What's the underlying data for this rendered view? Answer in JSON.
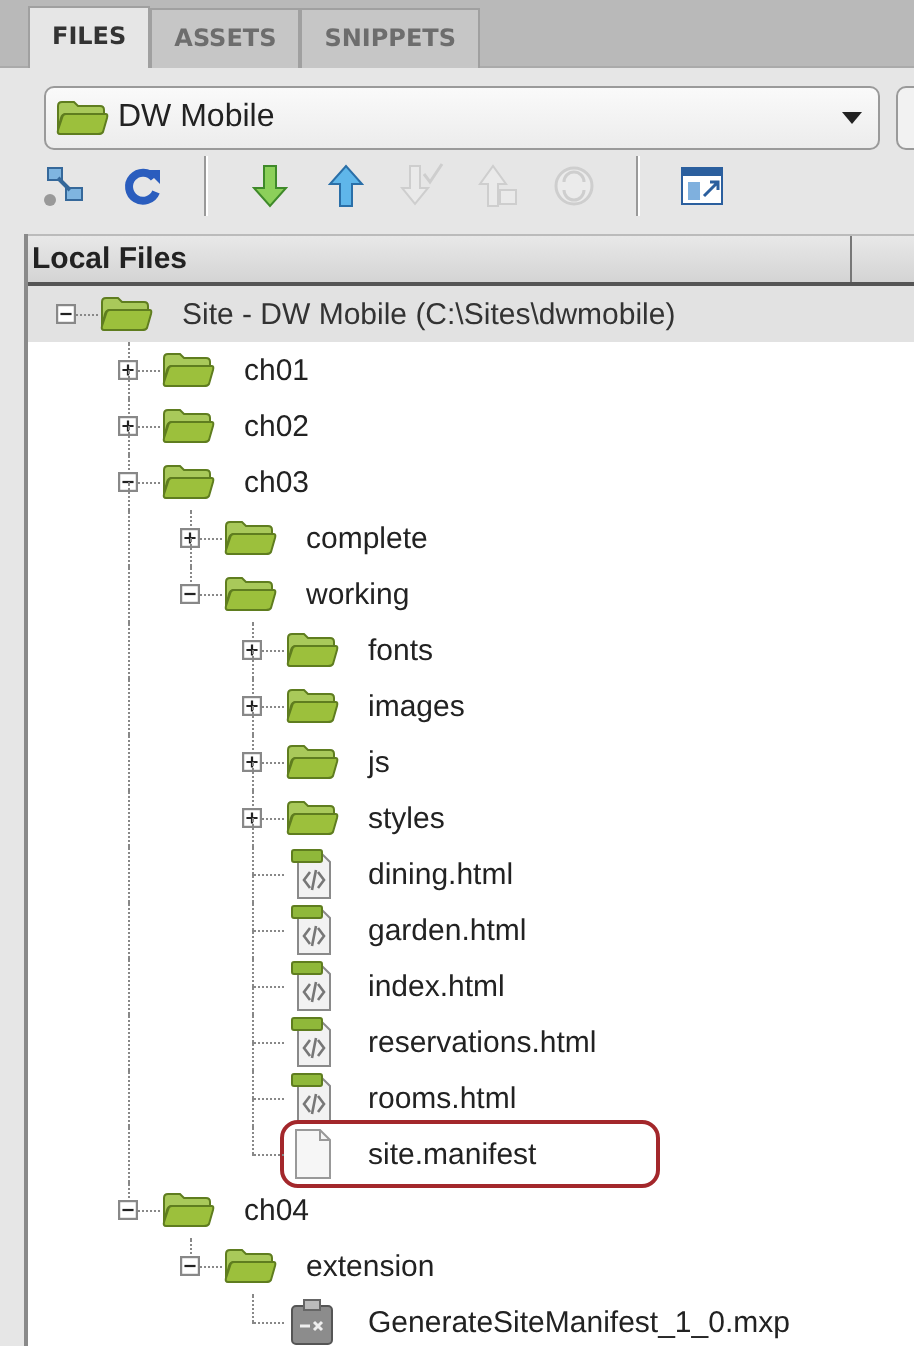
{
  "tabs": [
    {
      "label": "FILES",
      "selected": true
    },
    {
      "label": "ASSETS",
      "selected": false
    },
    {
      "label": "SNIPPETS",
      "selected": false
    }
  ],
  "site_select": {
    "value": "DW Mobile"
  },
  "toolbar": [
    {
      "kind": "connect",
      "disabled": false
    },
    {
      "kind": "refresh",
      "disabled": false
    },
    {
      "kind": "separator"
    },
    {
      "kind": "get",
      "disabled": false
    },
    {
      "kind": "put",
      "disabled": false
    },
    {
      "kind": "check_in",
      "disabled": true
    },
    {
      "kind": "check_out",
      "disabled": true
    },
    {
      "kind": "synchronize",
      "disabled": true
    },
    {
      "kind": "separator"
    },
    {
      "kind": "expand",
      "disabled": false
    }
  ],
  "file_list": {
    "column_1": "Local Files"
  },
  "tree": [
    {
      "name": "Site - DW Mobile (C:\\Sites\\dwmobile)",
      "kind": "folder",
      "expanded": true,
      "selected": true,
      "highlighted": false,
      "children": [
        {
          "name": "ch01",
          "kind": "folder",
          "expanded": false,
          "selected": false,
          "highlighted": false
        },
        {
          "name": "ch02",
          "kind": "folder",
          "expanded": false,
          "selected": false,
          "highlighted": false
        },
        {
          "name": "ch03",
          "kind": "folder",
          "expanded": true,
          "selected": false,
          "highlighted": false,
          "children": [
            {
              "name": "complete",
              "kind": "folder",
              "expanded": false,
              "selected": false,
              "highlighted": false
            },
            {
              "name": "working",
              "kind": "folder",
              "expanded": true,
              "selected": false,
              "highlighted": false,
              "children": [
                {
                  "name": "fonts",
                  "kind": "folder",
                  "expanded": false,
                  "selected": false,
                  "highlighted": false
                },
                {
                  "name": "images",
                  "kind": "folder",
                  "expanded": false,
                  "selected": false,
                  "highlighted": false
                },
                {
                  "name": "js",
                  "kind": "folder",
                  "expanded": false,
                  "selected": false,
                  "highlighted": false
                },
                {
                  "name": "styles",
                  "kind": "folder",
                  "expanded": false,
                  "selected": false,
                  "highlighted": false
                },
                {
                  "name": "dining.html",
                  "kind": "html",
                  "selected": false,
                  "highlighted": false
                },
                {
                  "name": "garden.html",
                  "kind": "html",
                  "selected": false,
                  "highlighted": false
                },
                {
                  "name": "index.html",
                  "kind": "html",
                  "selected": false,
                  "highlighted": false
                },
                {
                  "name": "reservations.html",
                  "kind": "html",
                  "selected": false,
                  "highlighted": false
                },
                {
                  "name": "rooms.html",
                  "kind": "html",
                  "selected": false,
                  "highlighted": false
                },
                {
                  "name": "site.manifest",
                  "kind": "blank",
                  "selected": false,
                  "highlighted": true
                }
              ]
            }
          ]
        },
        {
          "name": "ch04",
          "kind": "folder",
          "expanded": true,
          "selected": false,
          "highlighted": false,
          "children": [
            {
              "name": "extension",
              "kind": "folder",
              "expanded": true,
              "selected": false,
              "highlighted": false,
              "children": [
                {
                  "name": "GenerateSiteManifest_1_0.mxp",
                  "kind": "mxp",
                  "selected": false,
                  "highlighted": false
                }
              ]
            }
          ]
        }
      ]
    }
  ]
}
